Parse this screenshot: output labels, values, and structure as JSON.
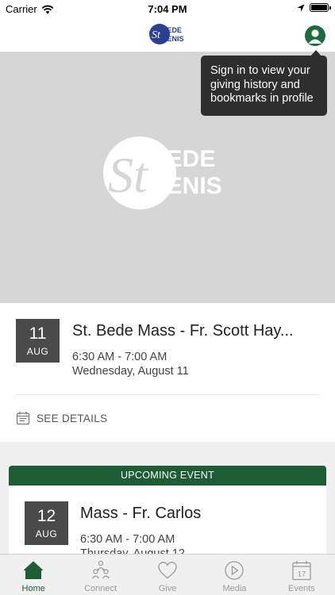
{
  "status_bar": {
    "carrier": "Carrier",
    "time": "7:04 PM"
  },
  "nav": {
    "logo_text_1": "BEDE",
    "logo_text_2": "DENIS",
    "logo_st": "St"
  },
  "hero": {
    "logo_text_1": "BEDE",
    "logo_text_2": "DENIS",
    "logo_st": "St"
  },
  "tooltip": {
    "text": "Sign in to view your giving history and bookmarks in profile"
  },
  "event1": {
    "day": "11",
    "month": "AUG",
    "title": "St. Bede Mass - Fr. Scott Hay...",
    "time": "6:30 AM - 7:00 AM",
    "date": "Wednesday, August 11",
    "see_details": "SEE DETAILS"
  },
  "upcoming": {
    "header": "UPCOMING EVENT",
    "day": "12",
    "month": "AUG",
    "title": "Mass - Fr. Carlos",
    "time": "6:30 AM - 7:00 AM",
    "date": "Thursday, August 12"
  },
  "tabs": [
    {
      "label": "Home",
      "icon": "home-icon",
      "active": true
    },
    {
      "label": "Connect",
      "icon": "people-icon",
      "active": false
    },
    {
      "label": "Give",
      "icon": "heart-icon",
      "active": false
    },
    {
      "label": "Media",
      "icon": "play-icon",
      "active": false
    },
    {
      "label": "Events",
      "icon": "calendar-icon",
      "active": false
    }
  ],
  "calendar_tab_day": "17",
  "colors": {
    "brand_green": "#1e5c36",
    "badge_gray": "#4a4a4a",
    "tooltip_bg": "#2e2e2e"
  }
}
